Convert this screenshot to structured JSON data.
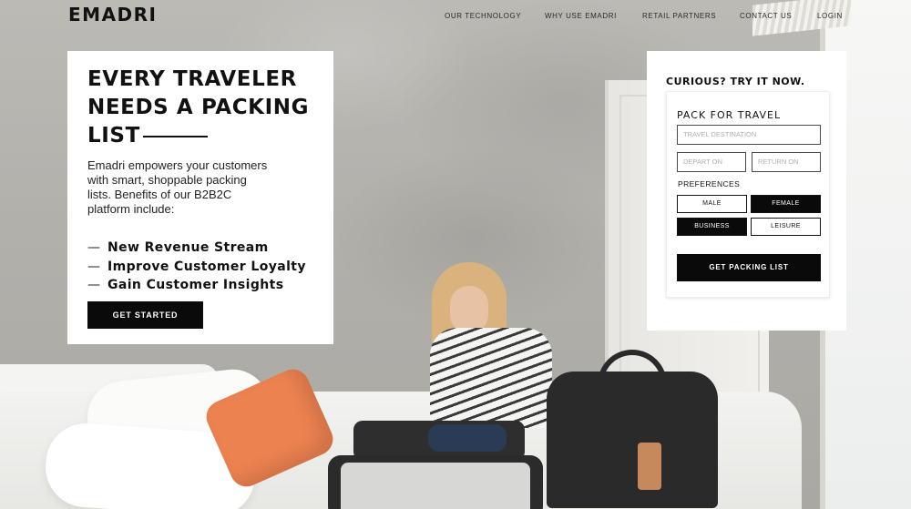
{
  "header": {
    "logo": "EMADRI",
    "nav": [
      {
        "label": "OUR TECHNOLOGY"
      },
      {
        "label": "WHY USE EMADRI"
      },
      {
        "label": "RETAIL PARTNERS"
      },
      {
        "label": "CONTACT US"
      },
      {
        "label": "LOGIN"
      }
    ]
  },
  "hero": {
    "title_line1": "EVERY TRAVELER",
    "title_line2": "NEEDS A PACKING",
    "title_line3": "LIST",
    "description": "Emadri empowers your customers with smart, shoppable packing lists. Benefits of our B2B2C platform include:",
    "benefits": [
      {
        "dash": "—",
        "text": "New Revenue Stream"
      },
      {
        "dash": "—",
        "text": "Improve Customer Loyalty"
      },
      {
        "dash": "—",
        "text": "Gain Customer Insights"
      }
    ],
    "cta": "GET STARTED"
  },
  "trial": {
    "heading": "CURIOUS? TRY IT NOW.",
    "form_title": "PACK FOR TRAVEL",
    "destination_placeholder": "TRAVEL DESTINATION",
    "depart_placeholder": "DEPART ON",
    "return_placeholder": "RETURN ON",
    "preferences_label": "PREFERENCES",
    "options": [
      {
        "label": "MALE",
        "selected": false
      },
      {
        "label": "FEMALE",
        "selected": true
      },
      {
        "label": "BUSINESS",
        "selected": true
      },
      {
        "label": "LEISURE",
        "selected": false
      }
    ],
    "submit": "GET PACKING LIST"
  },
  "colors": {
    "primary": "#0a0a0a",
    "card": "#ffffff",
    "accent_pillow": "#ec8250"
  }
}
